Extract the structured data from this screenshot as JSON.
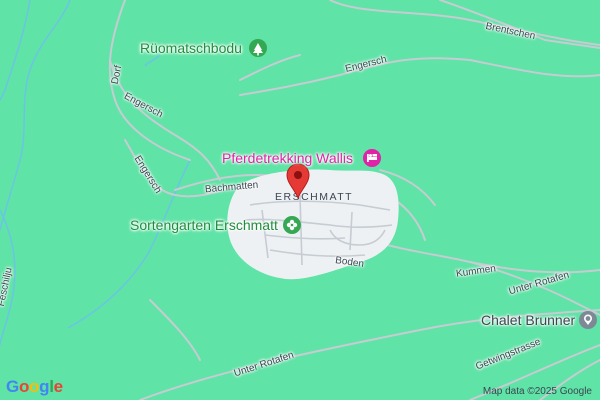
{
  "map": {
    "attribution": "Map data ©2025 Google",
    "logo": {
      "letters": [
        "G",
        "o",
        "o",
        "g",
        "l",
        "e"
      ],
      "colors": [
        "#4285F4",
        "#EA4335",
        "#FBBC05",
        "#4285F4",
        "#34A853",
        "#EA4335"
      ]
    },
    "colors": {
      "land": "#5fe3a6",
      "settlement": "#eef1f4",
      "road": "#c5ccd2",
      "stream": "#6cc3e8",
      "park_icon": "#34a853",
      "hotel": "#e023a8",
      "pin": "#e53935",
      "grey_icon": "#7d8a96"
    },
    "pois": {
      "park_1": {
        "name": "Rüomatschbodu",
        "icon": "tree-icon"
      },
      "hotel": {
        "name": "Pferdetrekking Wallis",
        "icon": "bed-icon"
      },
      "park_2": {
        "name": "Sortengarten Erschmatt",
        "icon": "flower-icon"
      },
      "place": {
        "name": "Chalet Brunner",
        "icon": "pin-icon"
      }
    },
    "village": "ERSCHMATT",
    "selected_pin": "map-marker-icon",
    "roads": {
      "brentschen": "Brentschen",
      "engersch_1": "Engersch",
      "engersch_2": "Engersch",
      "engersch_3": "Engersch",
      "dorf": "Dorf",
      "baechmatten": "Bächmatten",
      "boden": "Boden",
      "kummen": "Kummen",
      "unter_rotafen_1": "Unter Rotafen",
      "unter_rotafen_2": "Unter Rotafen",
      "getwingstrasse": "Getwingstrasse",
      "feschilju": "Feschilju"
    }
  }
}
